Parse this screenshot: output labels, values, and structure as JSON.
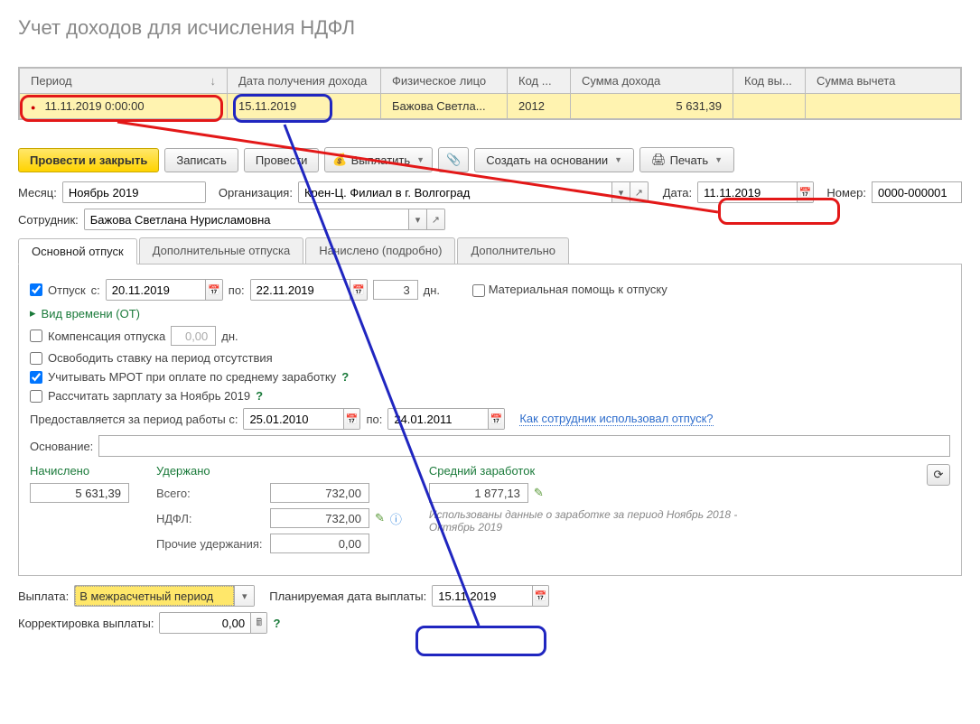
{
  "page_title": "Учет доходов для исчисления НДФЛ",
  "grid": {
    "columns": [
      "Период",
      "Дата получения дохода",
      "Физическое лицо",
      "Код ...",
      "Сумма дохода",
      "Код вы...",
      "Сумма вычета"
    ],
    "sort_col": 0,
    "rows": [
      {
        "period": "11.11.2019 0:00:00",
        "income_date": "15.11.2019",
        "person": "Бажова Светла...",
        "code": "2012",
        "amount": "5 631,39",
        "deduct_code": "",
        "deduct_amount": ""
      }
    ]
  },
  "toolbar": {
    "post_close": "Провести и закрыть",
    "save": "Записать",
    "post": "Провести",
    "pay": "Выплатить",
    "create_basis": "Создать на основании",
    "print": "Печать"
  },
  "header_form": {
    "month_label": "Месяц:",
    "month_value": "Ноябрь 2019",
    "org_label": "Организация:",
    "org_value": "Крен-Ц. Филиал в г. Волгоград",
    "date_label": "Дата:",
    "date_value": "11.11.2019",
    "number_label": "Номер:",
    "number_value": "0000-000001",
    "employee_label": "Сотрудник:",
    "employee_value": "Бажова Светлана Нурисламовна"
  },
  "tabs": [
    "Основной отпуск",
    "Дополнительные отпуска",
    "Начислено (подробно)",
    "Дополнительно"
  ],
  "active_tab": 0,
  "vacation_tab": {
    "chk_vacation_label": "Отпуск",
    "from_label": "с:",
    "from_value": "20.11.2019",
    "to_label": "по:",
    "to_value": "22.11.2019",
    "days_value": "3",
    "days_suffix": "дн.",
    "mat_help_label": "Материальная помощь к отпуску",
    "time_type_link": "Вид времени (ОТ)",
    "compensation_label": "Компенсация отпуска",
    "compensation_value": "0,00",
    "compensation_suffix": "дн.",
    "release_rate_label": "Освободить ставку на период отсутствия",
    "use_mrot_label": "Учитывать МРОТ при оплате по среднему заработку",
    "calc_salary_label": "Рассчитать зарплату за Ноябрь 2019",
    "period_work_label": "Предоставляется за период работы с:",
    "period_from": "25.01.2010",
    "period_to_label": "по:",
    "period_to": "24.01.2011",
    "how_used_link": "Как сотрудник использовал отпуск?",
    "basis_label": "Основание:",
    "basis_value": ""
  },
  "totals": {
    "accrued_label": "Начислено",
    "accrued_value": "5 631,39",
    "withheld_label": "Удержано",
    "vsego_label": "Всего:",
    "vsego_value": "732,00",
    "ndfl_label": "НДФЛ:",
    "ndfl_value": "732,00",
    "other_withheld_label": "Прочие удержания:",
    "other_withheld_value": "0,00",
    "avg_earn_label": "Средний заработок",
    "avg_earn_value": "1 877,13",
    "info_text": "Использованы данные о заработке за период Ноябрь 2018 - Октябрь 2019"
  },
  "payment": {
    "pay_label": "Выплата:",
    "pay_value": "В межрасчетный период",
    "planned_date_label": "Планируемая дата выплаты:",
    "planned_date_value": "15.11.2019",
    "correction_label": "Корректировка выплаты:",
    "correction_value": "0,00"
  }
}
